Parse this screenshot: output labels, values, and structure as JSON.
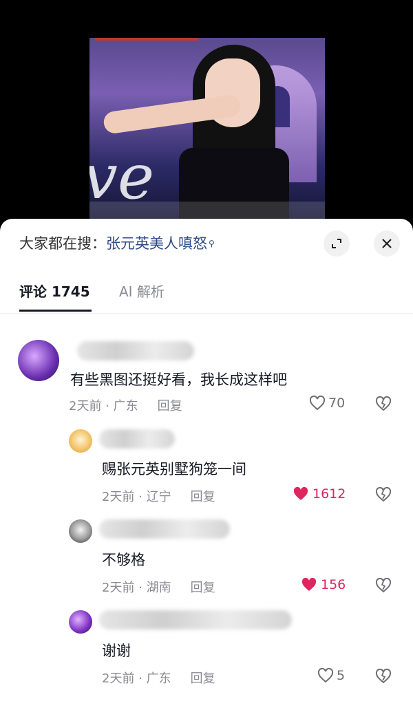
{
  "search": {
    "prefix": "大家都在搜：",
    "term": "张元英美人嗔怒",
    "search_icon": "search-icon"
  },
  "video": {
    "overlay_text": "ve"
  },
  "tabs": [
    {
      "label": "评论 1745"
    },
    {
      "label": "AI 解析"
    }
  ],
  "comments": [
    {
      "text": "有些黑图还挺好看，我长成这样吧",
      "time": "2天前 · 广东",
      "reply": "回复",
      "likes": "70",
      "liked": false
    },
    {
      "text": "赐张元英别墅狗笼一间",
      "time": "2天前 · 辽宁",
      "reply": "回复",
      "likes": "1612",
      "liked": true
    },
    {
      "text": "不够格",
      "time": "2天前 · 湖南",
      "reply": "回复",
      "likes": "156",
      "liked": true
    },
    {
      "text": "谢谢",
      "time": "2天前 · 广东",
      "reply": "回复",
      "likes": "5",
      "liked": false
    }
  ],
  "colors": {
    "accent": "#2f4a8a",
    "like_red": "#e0245e",
    "muted": "#8a8b91"
  }
}
